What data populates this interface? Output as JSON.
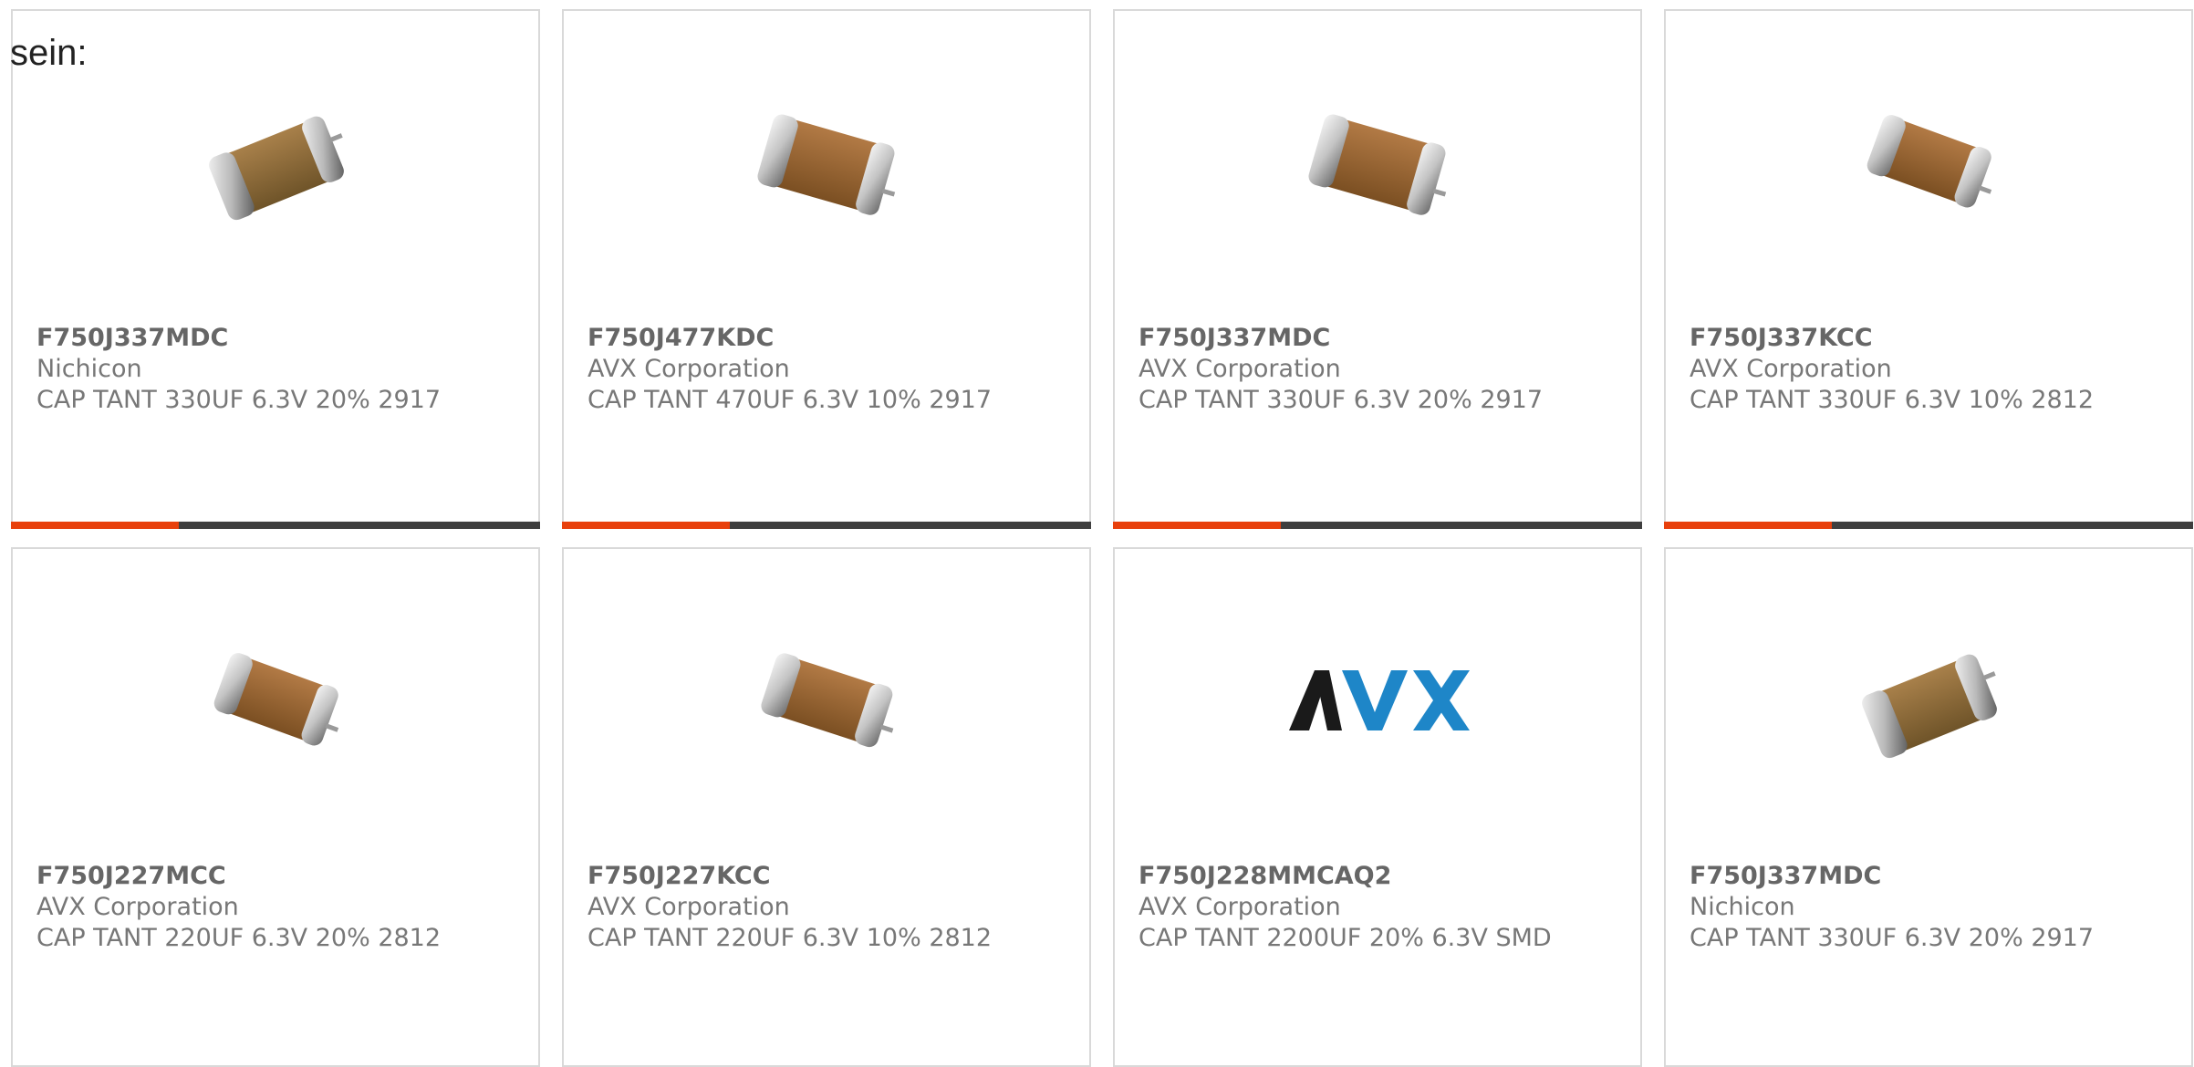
{
  "intro_text": "sein:",
  "colors": {
    "accent": "#e8400c",
    "bar_dark": "#3f3f3f",
    "card_border": "#d9d9d9",
    "text_bold": "#666666",
    "text": "#777777",
    "avx_dark": "#1a1a1a",
    "avx_blue": "#1e86c8"
  },
  "products": [
    {
      "part": "F750J337MDC",
      "manufacturer": "Nichicon",
      "description": "CAP TANT 330UF 6.3V 20% 2917",
      "image": "tantalum-capacitor-icon"
    },
    {
      "part": "F750J477KDC",
      "manufacturer": "AVX Corporation",
      "description": "CAP TANT 470UF 6.3V 10% 2917",
      "image": "tantalum-capacitor-icon"
    },
    {
      "part": "F750J337MDC",
      "manufacturer": "AVX Corporation",
      "description": "CAP TANT 330UF 6.3V 20% 2917",
      "image": "tantalum-capacitor-icon"
    },
    {
      "part": "F750J337KCC",
      "manufacturer": "AVX Corporation",
      "description": "CAP TANT 330UF 6.3V 10% 2812",
      "image": "tantalum-capacitor-icon"
    },
    {
      "part": "F750J227MCC",
      "manufacturer": "AVX Corporation",
      "description": "CAP TANT 220UF 6.3V 20% 2812",
      "image": "tantalum-capacitor-icon"
    },
    {
      "part": "F750J227KCC",
      "manufacturer": "AVX Corporation",
      "description": "CAP TANT 220UF 6.3V 10% 2812",
      "image": "tantalum-capacitor-icon"
    },
    {
      "part": "F750J228MMCAQ2",
      "manufacturer": "AVX Corporation",
      "description": "CAP TANT 2200UF 20% 6.3V SMD",
      "image": "avx-logo",
      "logo_text": "AVX"
    },
    {
      "part": "F750J337MDC",
      "manufacturer": "Nichicon",
      "description": "CAP TANT 330UF 6.3V 20% 2917",
      "image": "tantalum-capacitor-icon"
    }
  ]
}
